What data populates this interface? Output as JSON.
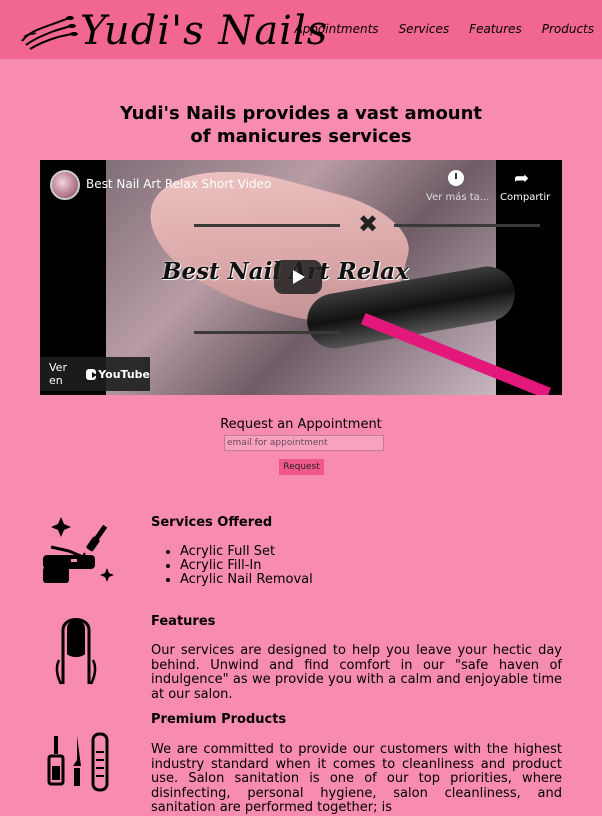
{
  "header": {
    "logo_text": "Yudi's Nails",
    "nav": [
      {
        "label": "Appointments"
      },
      {
        "label": "Services"
      },
      {
        "label": "Features"
      },
      {
        "label": "Products"
      }
    ]
  },
  "hero": {
    "title_line1": "Yudi's Nails provides a vast amount",
    "title_line2": "of manicures services"
  },
  "video": {
    "title": "Best Nail Art Relax Short Video",
    "overlay_text": "Best Nail Art Relax",
    "watch_later": "Ver más ta...",
    "share": "Compartir",
    "watch_on": "Ver en",
    "youtube": "YouTube"
  },
  "appointment": {
    "label": "Request an Appointment",
    "placeholder": "email for appointment",
    "button": "Request"
  },
  "services": {
    "heading": "Services Offered",
    "items": [
      "Acrylic Full Set",
      "Acrylic Fill-In",
      "Acrylic Nail Removal"
    ]
  },
  "features": {
    "heading": "Features",
    "text": "Our services are designed to help you leave your hectic day behind. Unwind and find comfort in our \"safe haven of indulgence\" as we provide you with a calm and enjoyable time at our salon."
  },
  "products": {
    "heading": "Premium Products",
    "text": "We are committed to provide our customers with the highest industry standard when it comes to cleanliness and product use. Salon sanitation is one of our top priorities, where disinfecting, personal hygiene, salon cleanliness, and sanitation are performed together; is"
  },
  "colors": {
    "background": "#f88cb0",
    "header": "#f1678f",
    "button": "#f1588a"
  }
}
